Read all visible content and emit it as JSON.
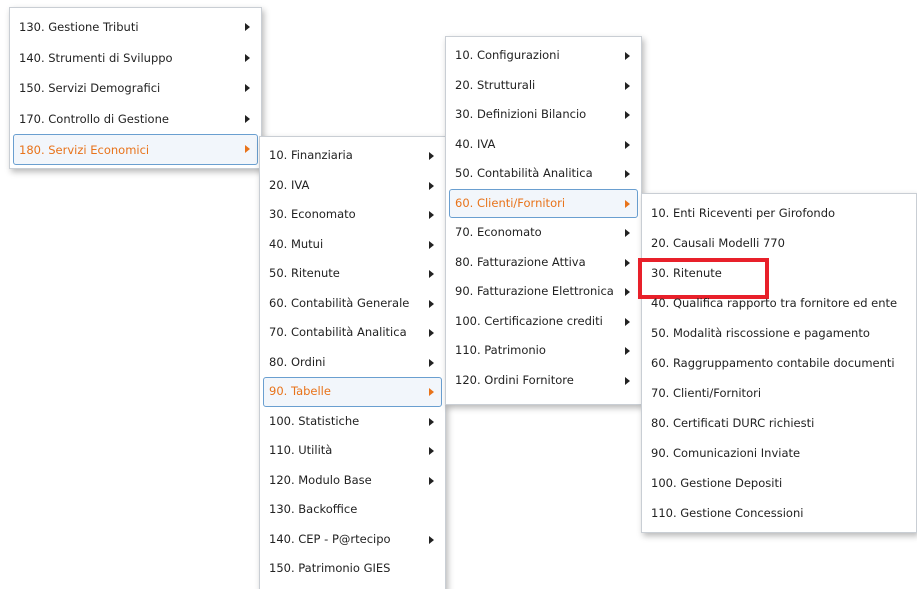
{
  "menu_level1": [
    {
      "label": "130. Gestione Tributi",
      "has_sub": true
    },
    {
      "label": "140. Strumenti di Sviluppo",
      "has_sub": true
    },
    {
      "label": "150. Servizi Demografici",
      "has_sub": true
    },
    {
      "label": "170. Controllo di Gestione",
      "has_sub": true
    },
    {
      "label": "180. Servizi Economici",
      "has_sub": true,
      "active": true
    }
  ],
  "menu_level2": [
    {
      "label": "10. Finanziaria",
      "has_sub": true
    },
    {
      "label": "20. IVA",
      "has_sub": true
    },
    {
      "label": "30. Economato",
      "has_sub": true
    },
    {
      "label": "40. Mutui",
      "has_sub": true
    },
    {
      "label": "50. Ritenute",
      "has_sub": true
    },
    {
      "label": "60. Contabilità Generale",
      "has_sub": true
    },
    {
      "label": "70. Contabilità Analitica",
      "has_sub": true
    },
    {
      "label": "80. Ordini",
      "has_sub": true
    },
    {
      "label": "90. Tabelle",
      "has_sub": true,
      "active": true
    },
    {
      "label": "100. Statistiche",
      "has_sub": true
    },
    {
      "label": "110. Utilità",
      "has_sub": true
    },
    {
      "label": "120. Modulo Base",
      "has_sub": true
    },
    {
      "label": "130. Backoffice",
      "has_sub": false
    },
    {
      "label": "140. CEP - P@rtecipo",
      "has_sub": true
    },
    {
      "label": "150. Patrimonio GIES",
      "has_sub": false
    }
  ],
  "menu_level3": [
    {
      "label": "10. Configurazioni",
      "has_sub": true
    },
    {
      "label": "20. Strutturali",
      "has_sub": true
    },
    {
      "label": "30. Definizioni Bilancio",
      "has_sub": true
    },
    {
      "label": "40. IVA",
      "has_sub": true
    },
    {
      "label": "50. Contabilità Analitica",
      "has_sub": true
    },
    {
      "label": "60. Clienti/Fornitori",
      "has_sub": true,
      "active": true
    },
    {
      "label": "70. Economato",
      "has_sub": true
    },
    {
      "label": "80. Fatturazione Attiva",
      "has_sub": true
    },
    {
      "label": "90. Fatturazione Elettronica",
      "has_sub": true
    },
    {
      "label": "100. Certificazione crediti",
      "has_sub": true
    },
    {
      "label": "110. Patrimonio",
      "has_sub": true
    },
    {
      "label": "120. Ordini Fornitore",
      "has_sub": true
    }
  ],
  "menu_level4": [
    {
      "label": "10. Enti Riceventi per Girofondo",
      "has_sub": false
    },
    {
      "label": "20. Causali Modelli 770",
      "has_sub": false
    },
    {
      "label": "30. Ritenute",
      "has_sub": false,
      "highlight": true
    },
    {
      "label": "40. Qualifica rapporto tra fornitore ed ente",
      "has_sub": false
    },
    {
      "label": "50. Modalità riscossione e pagamento",
      "has_sub": false
    },
    {
      "label": "60. Raggruppamento contabile documenti",
      "has_sub": false
    },
    {
      "label": "70. Clienti/Fornitori",
      "has_sub": false
    },
    {
      "label": "80. Certificati DURC richiesti",
      "has_sub": false
    },
    {
      "label": "90. Comunicazioni Inviate",
      "has_sub": false
    },
    {
      "label": "100. Gestione Depositi",
      "has_sub": false
    },
    {
      "label": "110. Gestione Concessioni",
      "has_sub": false
    }
  ],
  "colors": {
    "active_text": "#e8731a",
    "active_border": "#6a9fd0",
    "highlight_box": "#e8202a"
  }
}
